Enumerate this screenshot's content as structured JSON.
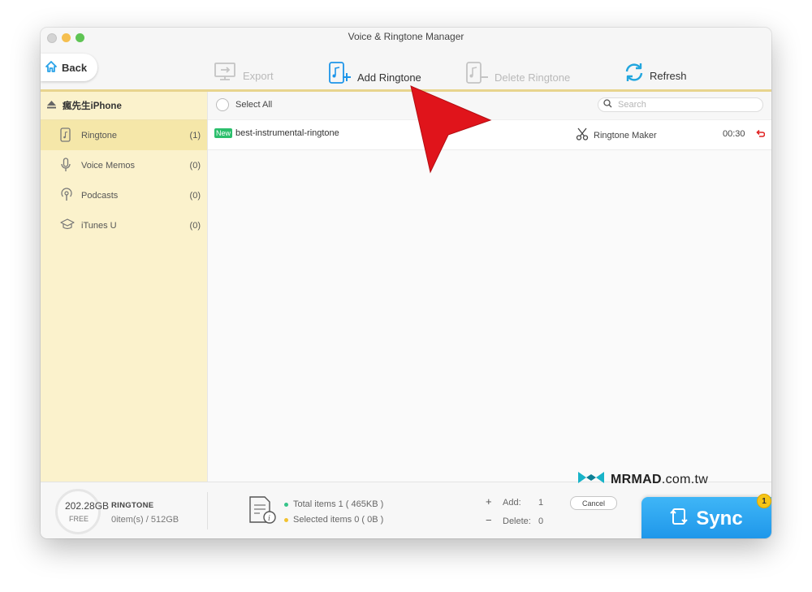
{
  "window": {
    "title": "Voice & Ringtone Manager"
  },
  "toolbar": {
    "back_label": "Back",
    "export_label": "Export",
    "add_ringtone_label": "Add Ringtone",
    "delete_ringtone_label": "Delete Ringtone",
    "refresh_label": "Refresh"
  },
  "sidebar": {
    "device_name": "瘋先生iPhone",
    "items": [
      {
        "label": "Ringtone",
        "count": "(1)",
        "icon": "phone-music-icon"
      },
      {
        "label": "Voice Memos",
        "count": "(0)",
        "icon": "microphone-icon"
      },
      {
        "label": "Podcasts",
        "count": "(0)",
        "icon": "podcast-icon"
      },
      {
        "label": "iTunes U",
        "count": "(0)",
        "icon": "graduation-cap-icon"
      }
    ]
  },
  "list": {
    "select_all_label": "Select All",
    "search_placeholder": "Search",
    "rows": [
      {
        "badge": "New",
        "name": "best-instrumental-ringtone",
        "maker_label": "Ringtone Maker",
        "duration": "00:30"
      }
    ]
  },
  "footer": {
    "free_space": "202.28GB",
    "free_label": "FREE",
    "category": "RINGTONE",
    "usage": "0item(s) / 512GB",
    "total_items": "Total items 1 ( 465KB )",
    "selected_items": "Selected items 0 ( 0B )",
    "add_sign": "+",
    "add_label": "Add:",
    "add_value": "1",
    "delete_sign": "−",
    "delete_label": "Delete:",
    "delete_value": "0",
    "cancel_label": "Cancel",
    "sync_label": "Sync",
    "sync_badge": "1"
  },
  "watermark": {
    "brand": "MRMAD",
    "suffix": ".com.tw"
  },
  "colors": {
    "sidebar_bg": "#fbf2cc",
    "sidebar_active": "#f5e7a9",
    "accent_blue": "#1d95e9",
    "new_badge": "#2bbf6c",
    "annotation_arrow": "#e0141b",
    "badge_yellow": "#f5c518"
  }
}
